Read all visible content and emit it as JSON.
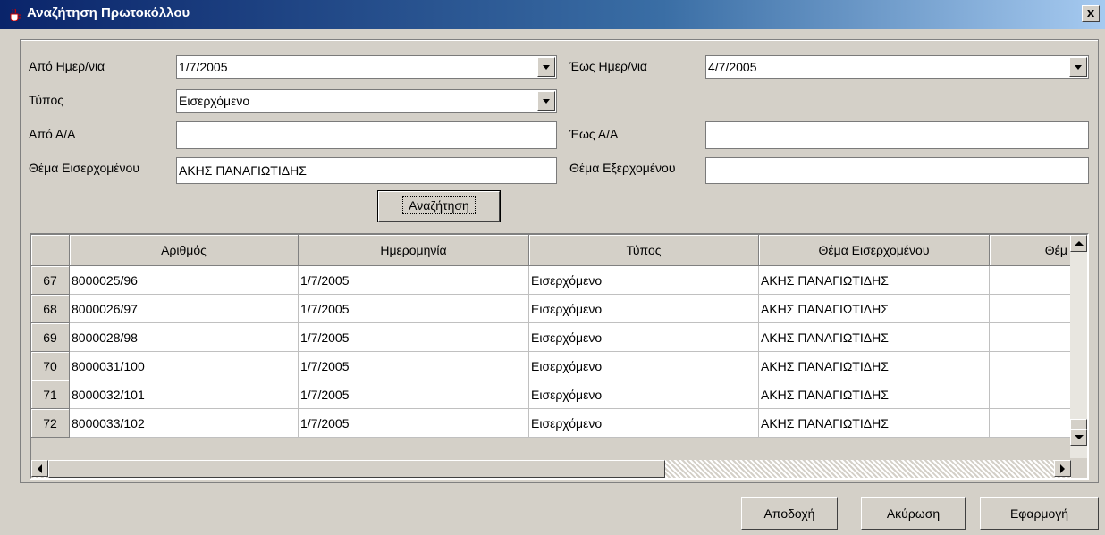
{
  "window": {
    "title": "Αναζήτηση Πρωτοκόλλου",
    "close_label": "x"
  },
  "form": {
    "from_date_label": "Από Ημερ/νια",
    "from_date_value": "1/7/2005",
    "to_date_label": "Έως Ημερ/νια",
    "to_date_value": "4/7/2005",
    "type_label": "Τύπος",
    "type_value": "Εισερχόμενο",
    "from_aa_label": "Από Α/Α",
    "from_aa_value": "",
    "to_aa_label": "Έως Α/Α",
    "to_aa_value": "",
    "incoming_subject_label": "Θέμα Εισερχομένου",
    "incoming_subject_value": "ΑΚΗΣ ΠΑΝΑΓΙΩΤΙΔΗΣ",
    "outgoing_subject_label": "Θέμα Εξερχομένου",
    "outgoing_subject_value": "",
    "search_label": "Αναζήτηση"
  },
  "table": {
    "columns": [
      "Αριθμός",
      "Ημερομηνία",
      "Τύπος",
      "Θέμα Εισερχομένου",
      "Θέμ"
    ],
    "rows": [
      {
        "num": "67",
        "number": "8000025/96",
        "date": "1/7/2005",
        "type": "Εισερχόμενο",
        "subject": "ΑΚΗΣ ΠΑΝΑΓΙΩΤΙΔΗΣ"
      },
      {
        "num": "68",
        "number": "8000026/97",
        "date": "1/7/2005",
        "type": "Εισερχόμενο",
        "subject": "ΑΚΗΣ ΠΑΝΑΓΙΩΤΙΔΗΣ"
      },
      {
        "num": "69",
        "number": "8000028/98",
        "date": "1/7/2005",
        "type": "Εισερχόμενο",
        "subject": "ΑΚΗΣ ΠΑΝΑΓΙΩΤΙΔΗΣ"
      },
      {
        "num": "70",
        "number": "8000031/100",
        "date": "1/7/2005",
        "type": "Εισερχόμενο",
        "subject": "ΑΚΗΣ ΠΑΝΑΓΙΩΤΙΔΗΣ"
      },
      {
        "num": "71",
        "number": "8000032/101",
        "date": "1/7/2005",
        "type": "Εισερχόμενο",
        "subject": "ΑΚΗΣ ΠΑΝΑΓΙΩΤΙΔΗΣ"
      },
      {
        "num": "72",
        "number": "8000033/102",
        "date": "1/7/2005",
        "type": "Εισερχόμενο",
        "subject": "ΑΚΗΣ ΠΑΝΑΓΙΩΤΙΔΗΣ"
      }
    ]
  },
  "footer": {
    "accept_label": "Αποδοχή",
    "cancel_label": "Ακύρωση",
    "apply_label": "Εφαρμογή"
  },
  "colors": {
    "title_start": "#0a246a",
    "title_end": "#a6caf0",
    "face": "#d4d0c8"
  },
  "icons": {
    "app": "java-cup-icon"
  }
}
